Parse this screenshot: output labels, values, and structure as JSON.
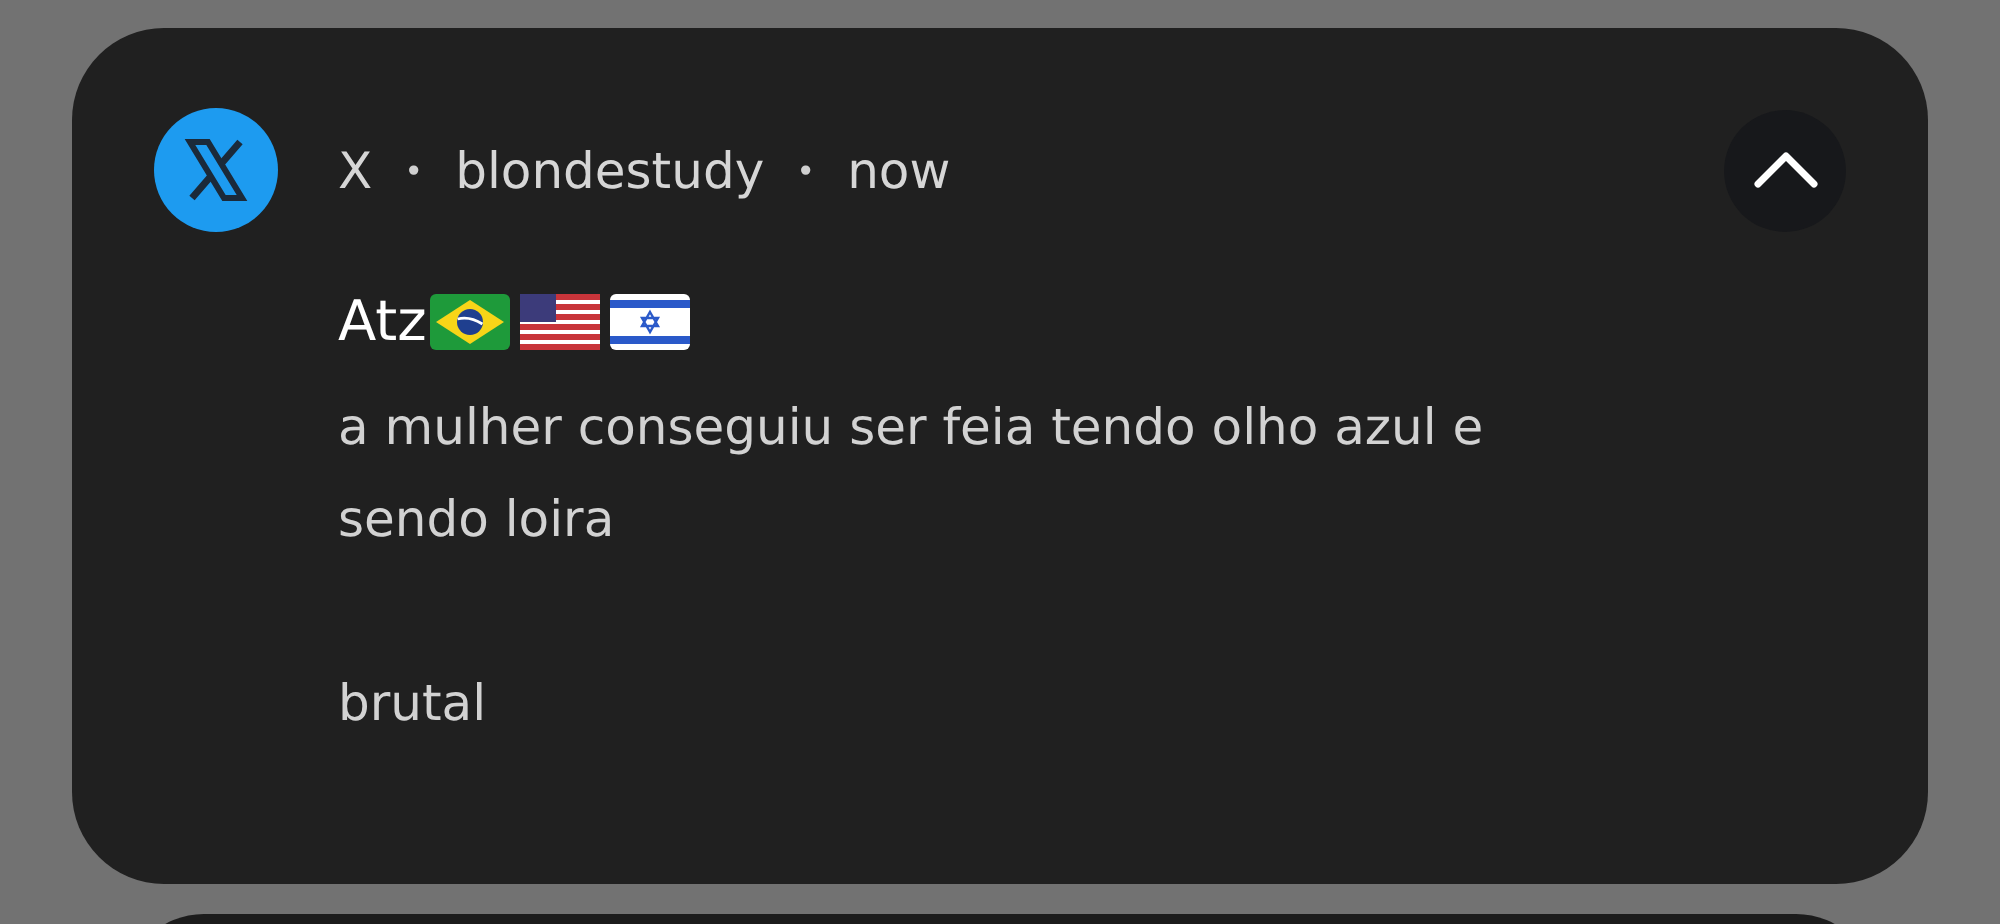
{
  "notification": {
    "header": [
      {
        "kind": "app",
        "text": "X"
      },
      {
        "kind": "separator",
        "text": "•"
      },
      {
        "kind": "account",
        "text": "blondestudy"
      },
      {
        "kind": "separator",
        "text": "•"
      },
      {
        "kind": "time",
        "text": "now"
      }
    ],
    "expanded": true,
    "title": "Atz",
    "body": [
      "a mulher conseguiu ser feia tendo olho azul e\nsendo loira",
      "brutal"
    ]
  }
}
